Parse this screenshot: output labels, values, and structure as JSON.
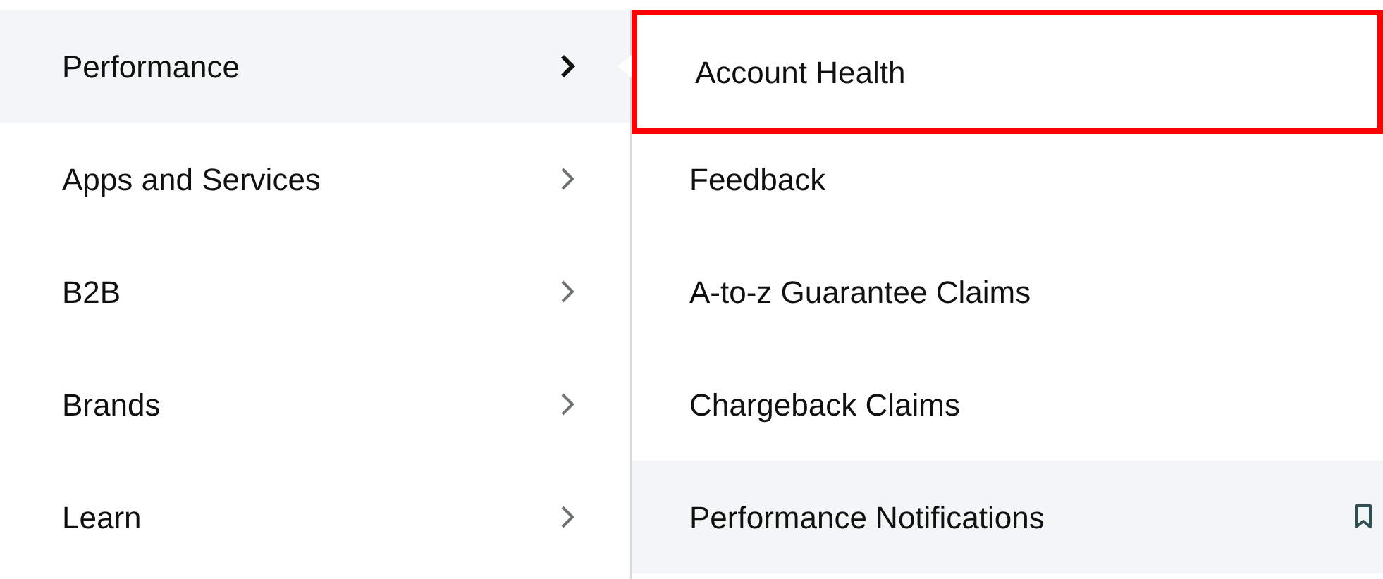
{
  "categories": [
    {
      "label": "Performance",
      "selected": true
    },
    {
      "label": "Apps and Services",
      "selected": false
    },
    {
      "label": "B2B",
      "selected": false
    },
    {
      "label": "Brands",
      "selected": false
    },
    {
      "label": "Learn",
      "selected": false
    }
  ],
  "submenu": [
    {
      "label": "Account Health",
      "hovered": false,
      "outlined": true,
      "bookmark": false
    },
    {
      "label": "Feedback",
      "hovered": false,
      "outlined": false,
      "bookmark": false
    },
    {
      "label": "A-to-z Guarantee Claims",
      "hovered": false,
      "outlined": false,
      "bookmark": false
    },
    {
      "label": "Chargeback Claims",
      "hovered": false,
      "outlined": false,
      "bookmark": false
    },
    {
      "label": "Performance Notifications",
      "hovered": true,
      "outlined": false,
      "bookmark": true
    }
  ]
}
